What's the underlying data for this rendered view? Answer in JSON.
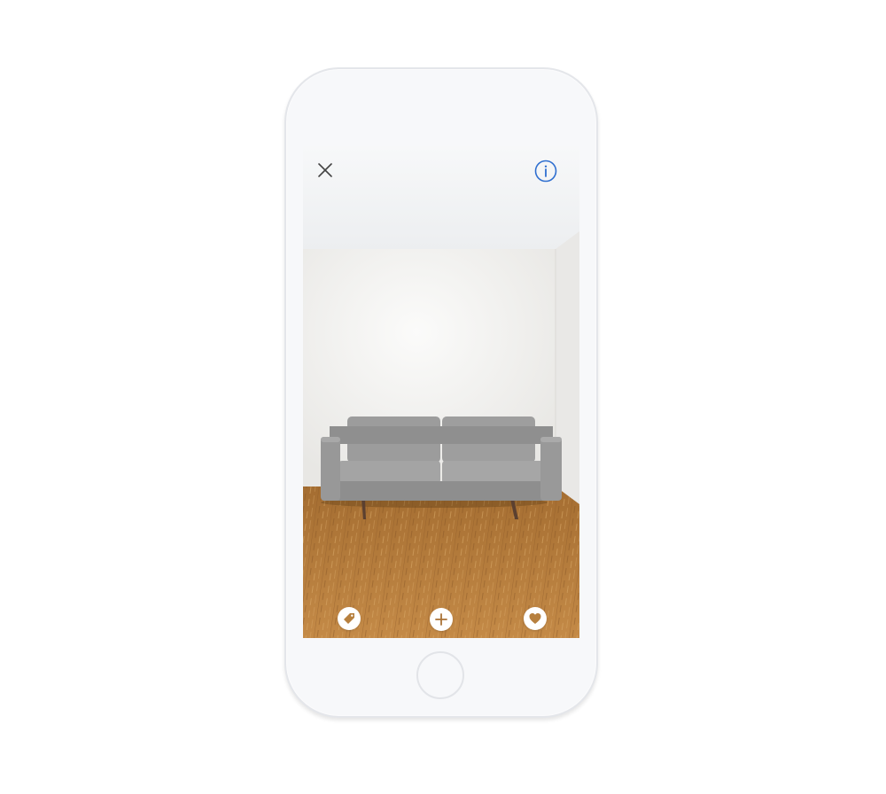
{
  "screen": {
    "toolbar": {
      "close_icon": "close-icon",
      "info_icon": "info-circle-icon",
      "info_color": "#2f6fd0"
    },
    "actions": [
      {
        "name": "price-tag-button",
        "icon": "price-tag-icon"
      },
      {
        "name": "add-button",
        "icon": "plus-icon"
      },
      {
        "name": "favorite-button",
        "icon": "heart-icon"
      }
    ],
    "colors": {
      "sofa": "#9a9a9a",
      "floor": "#b9803f",
      "wall": "#f1f0ee"
    }
  },
  "device": {
    "home_button_icon": "home-button"
  }
}
